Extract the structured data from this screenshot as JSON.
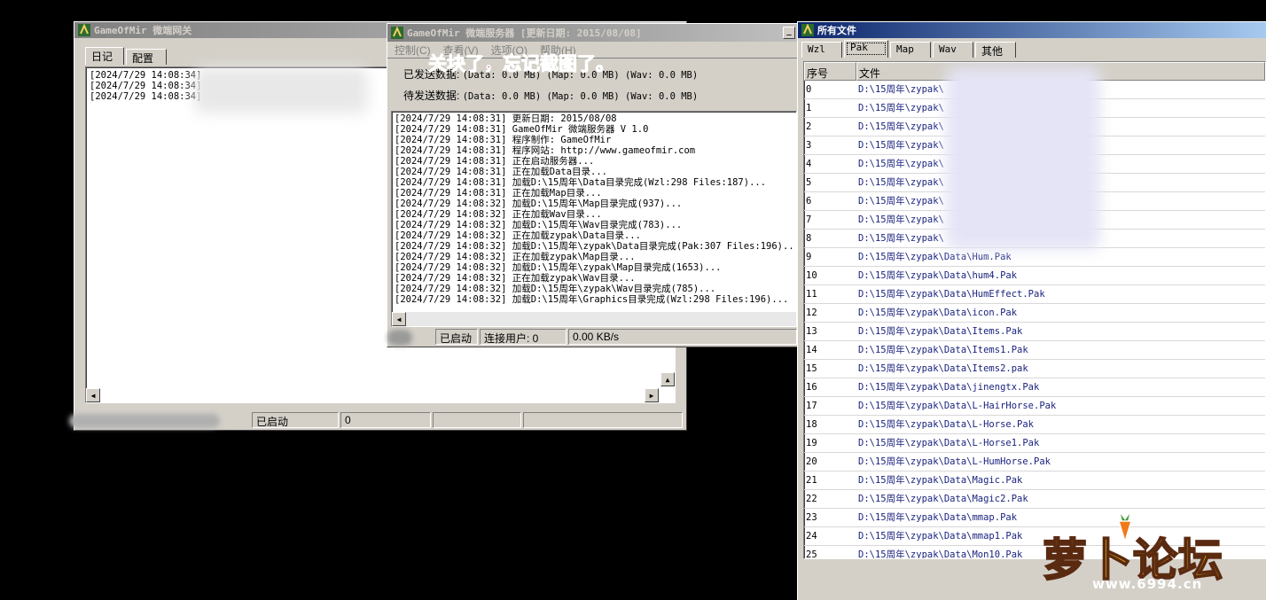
{
  "gateway": {
    "title": "GameOfMir 微端网关",
    "tabs": [
      "日记",
      "配置"
    ],
    "log": [
      "[2024/7/29 14:08:34]",
      "[2024/7/29 14:08:34]",
      "[2024/7/29 14:08:34]"
    ],
    "status": {
      "state": "已启动",
      "count": "0"
    }
  },
  "server": {
    "title": "GameOfMir 微端服务器 [更新日期: 2015/08/08]",
    "menu": [
      "控制(C)",
      "查看(V)",
      "选项(O)",
      "帮助(H)"
    ],
    "overlay_text": "关块了，忘记截图了。",
    "sent_label": "已发送数据:",
    "sent_value": "(Data: 0.0 MB)  (Map: 0.0 MB)  (Wav: 0.0 MB)",
    "pending_label": "待发送数据:",
    "pending_value": "(Data: 0.0 MB)  (Map: 0.0 MB)  (Wav: 0.0 MB)",
    "log": [
      "[2024/7/29 14:08:31] 更新日期: 2015/08/08",
      "[2024/7/29 14:08:31] GameOfMir 微端服务器 V 1.0",
      "[2024/7/29 14:08:31] 程序制作: GameOfMir",
      "[2024/7/29 14:08:31] 程序网站: http://www.gameofmir.com",
      "[2024/7/29 14:08:31] 正在启动服务器...",
      "[2024/7/29 14:08:31] 正在加载Data目录...",
      "[2024/7/29 14:08:31] 加载D:\\15周年\\Data目录完成(Wzl:298 Files:187)...",
      "[2024/7/29 14:08:31] 正在加载Map目录...",
      "[2024/7/29 14:08:32] 加载D:\\15周年\\Map目录完成(937)...",
      "[2024/7/29 14:08:32] 正在加载Wav目录...",
      "[2024/7/29 14:08:32] 加载D:\\15周年\\Wav目录完成(783)...",
      "[2024/7/29 14:08:32] 正在加载zypak\\Data目录...",
      "[2024/7/29 14:08:32] 加载D:\\15周年\\zypak\\Data目录完成(Pak:307 Files:196)...",
      "[2024/7/29 14:08:32] 正在加载zypak\\Map目录...",
      "[2024/7/29 14:08:32] 加载D:\\15周年\\zypak\\Map目录完成(1653)...",
      "[2024/7/29 14:08:32] 正在加载zypak\\Wav目录...",
      "[2024/7/29 14:08:32] 加载D:\\15周年\\zypak\\Wav目录完成(785)...",
      "[2024/7/29 14:08:32] 加载D:\\15周年\\Graphics目录完成(Wzl:298 Files:196)..."
    ],
    "status": {
      "state": "已启动",
      "users": "连接用户: 0",
      "speed": "0.00 KB/s"
    }
  },
  "files": {
    "title": "所有文件",
    "tabs": [
      "Wzl",
      "Pak",
      "Map",
      "Wav",
      "其他"
    ],
    "columns": [
      "序号",
      "文件"
    ],
    "rows": [
      [
        "0",
        "D:\\15周年\\zypak\\"
      ],
      [
        "1",
        "D:\\15周年\\zypak\\"
      ],
      [
        "2",
        "D:\\15周年\\zypak\\"
      ],
      [
        "3",
        "D:\\15周年\\zypak\\"
      ],
      [
        "4",
        "D:\\15周年\\zypak\\"
      ],
      [
        "5",
        "D:\\15周年\\zypak\\"
      ],
      [
        "6",
        "D:\\15周年\\zypak\\"
      ],
      [
        "7",
        "D:\\15周年\\zypak\\"
      ],
      [
        "8",
        "D:\\15周年\\zypak\\"
      ],
      [
        "9",
        "D:\\15周年\\zypak\\Data\\Hum.Pak"
      ],
      [
        "10",
        "D:\\15周年\\zypak\\Data\\hum4.Pak"
      ],
      [
        "11",
        "D:\\15周年\\zypak\\Data\\HumEffect.Pak"
      ],
      [
        "12",
        "D:\\15周年\\zypak\\Data\\icon.Pak"
      ],
      [
        "13",
        "D:\\15周年\\zypak\\Data\\Items.Pak"
      ],
      [
        "14",
        "D:\\15周年\\zypak\\Data\\Items1.Pak"
      ],
      [
        "15",
        "D:\\15周年\\zypak\\Data\\Items2.pak"
      ],
      [
        "16",
        "D:\\15周年\\zypak\\Data\\jinengtx.Pak"
      ],
      [
        "17",
        "D:\\15周年\\zypak\\Data\\L-HairHorse.Pak"
      ],
      [
        "18",
        "D:\\15周年\\zypak\\Data\\L-Horse.Pak"
      ],
      [
        "19",
        "D:\\15周年\\zypak\\Data\\L-Horse1.Pak"
      ],
      [
        "20",
        "D:\\15周年\\zypak\\Data\\L-HumHorse.Pak"
      ],
      [
        "21",
        "D:\\15周年\\zypak\\Data\\Magic.Pak"
      ],
      [
        "22",
        "D:\\15周年\\zypak\\Data\\Magic2.Pak"
      ],
      [
        "23",
        "D:\\15周年\\zypak\\Data\\mmap.Pak"
      ],
      [
        "24",
        "D:\\15周年\\zypak\\Data\\mmap1.Pak"
      ],
      [
        "25",
        "D:\\15周年\\zypak\\Data\\Mon10.Pak"
      ]
    ]
  },
  "watermark": {
    "brand": "萝卜论坛",
    "url": "www.6994.cn"
  },
  "colors": {
    "overlay_text": "#e0302a",
    "path_text": "#1a237e",
    "title_active": "#0a246a"
  }
}
